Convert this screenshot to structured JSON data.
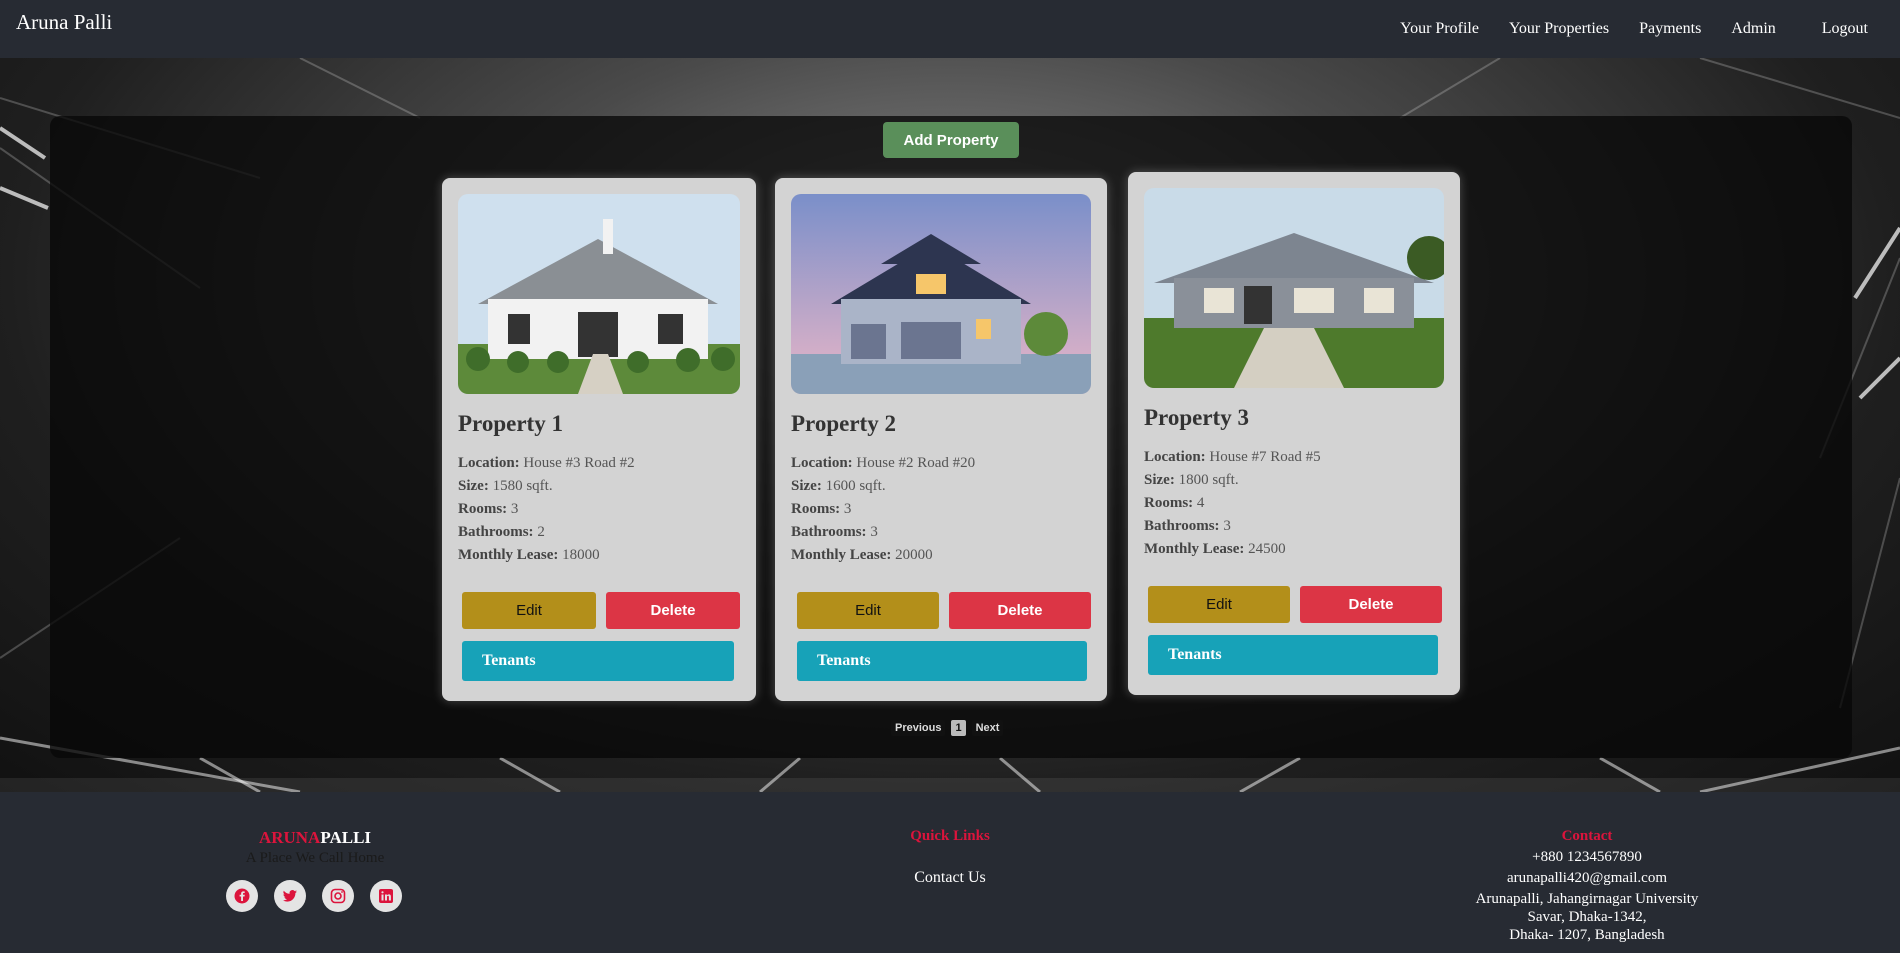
{
  "navbar": {
    "brand": "Aruna Palli",
    "links": [
      "Your Profile",
      "Your Properties",
      "Payments",
      "Admin",
      "Logout"
    ]
  },
  "main": {
    "add_property_label": "Add Property",
    "labels": {
      "location": "Location:",
      "size": "Size:",
      "rooms": "Rooms:",
      "bathrooms": "Bathrooms:",
      "monthly_lease": "Monthly Lease:"
    },
    "properties": [
      {
        "title": "Property 1",
        "location": "House #3 Road #2",
        "size": "1580 sqft.",
        "rooms": "3",
        "bathrooms": "2",
        "monthly_lease": "18000"
      },
      {
        "title": "Property 2",
        "location": "House #2 Road #20",
        "size": "1600 sqft.",
        "rooms": "3",
        "bathrooms": "3",
        "monthly_lease": "20000"
      },
      {
        "title": "Property 3",
        "location": "House #7 Road #5",
        "size": "1800 sqft.",
        "rooms": "4",
        "bathrooms": "3",
        "monthly_lease": "24500"
      }
    ],
    "buttons": {
      "edit": "Edit",
      "delete": "Delete",
      "tenants": "Tenants"
    },
    "pagination": {
      "previous": "Previous",
      "current": "1",
      "next": "Next"
    }
  },
  "footer": {
    "brand_part1": "ARUNA",
    "brand_part2": "PALLI",
    "tagline": "A Place We Call Home",
    "socials": [
      "facebook-icon",
      "twitter-icon",
      "instagram-icon",
      "linkedin-icon"
    ],
    "quick_links_title": "Quick Links",
    "quick_links": [
      "Contact Us"
    ],
    "contact_title": "Contact",
    "phone": "+880 1234567890",
    "email": "arunapalli420@gmail.com",
    "address_line1": "Arunapalli, Jahangirnagar University",
    "address_line2": "Savar, Dhaka-1342,",
    "address_line3": "Dhaka- 1207, Bangladesh"
  },
  "colors": {
    "accent_red": "#dc143c",
    "add_button": "#5a8f5a",
    "edit_button": "#b38f1a",
    "delete_button": "#dc3545",
    "tenants_button": "#17a2b8",
    "nav_bg": "#272b33"
  }
}
